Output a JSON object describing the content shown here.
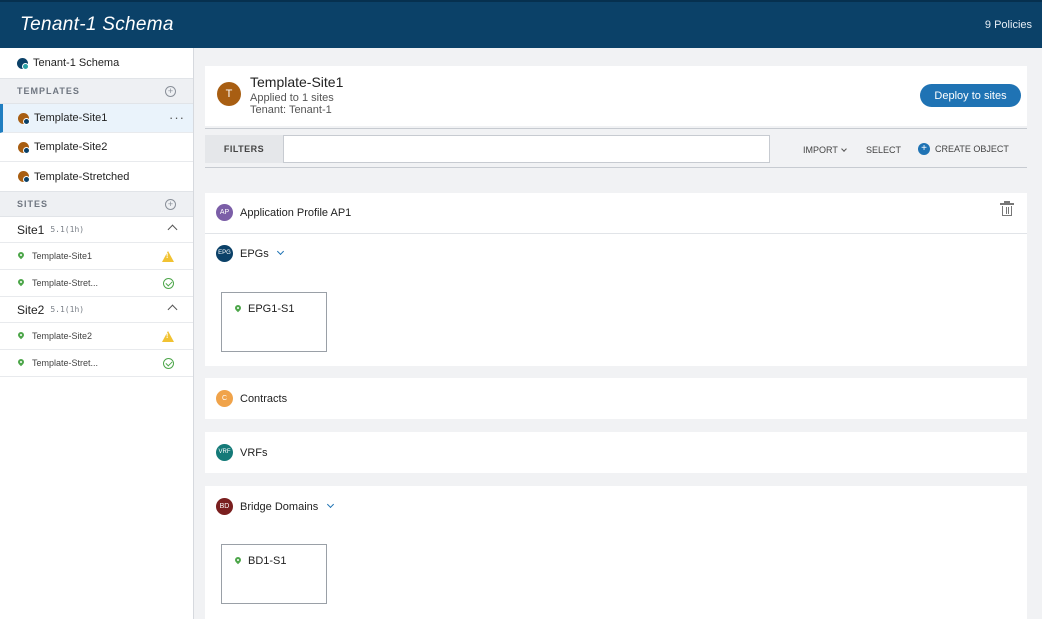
{
  "header": {
    "title": "Tenant-1 Schema",
    "policies": "9 Policies"
  },
  "sidebar": {
    "schema_label": "Tenant-1 Schema",
    "templates_heading": "TEMPLATES",
    "templates": [
      {
        "label": "Template-Site1",
        "active": true,
        "more": "···"
      },
      {
        "label": "Template-Site2"
      },
      {
        "label": "Template-Stretched"
      }
    ],
    "sites_heading": "SITES",
    "sites": [
      {
        "name": "Site1",
        "version": "5.1(1h)",
        "templates": [
          {
            "label": "Template-Site1",
            "status": "warning"
          },
          {
            "label": "Template-Stret...",
            "status": "ok"
          }
        ]
      },
      {
        "name": "Site2",
        "version": "5.1(1h)",
        "templates": [
          {
            "label": "Template-Site2",
            "status": "warning"
          },
          {
            "label": "Template-Stret...",
            "status": "ok"
          }
        ]
      }
    ]
  },
  "template_header": {
    "avatar": "T",
    "name": "Template-Site1",
    "applied": "Applied to 1 sites",
    "tenant": "Tenant: Tenant-1",
    "deploy_label": "Deploy to sites"
  },
  "filterbar": {
    "filters_label": "FILTERS",
    "filter_value": "",
    "import_label": "IMPORT",
    "select_label": "SELECT",
    "create_label": "CREATE OBJECT"
  },
  "app_profile": {
    "badge": "AP",
    "label": "Application Profile AP1"
  },
  "epgs": {
    "badge": "EPG",
    "label": "EPGs",
    "items": [
      "EPG1-S1"
    ]
  },
  "contracts": {
    "badge": "C",
    "label": "Contracts"
  },
  "vrfs": {
    "badge": "VRF",
    "label": "VRFs"
  },
  "bridge_domains": {
    "badge": "BD",
    "label": "Bridge Domains",
    "items": [
      "BD1-S1"
    ]
  },
  "colors": {
    "header_bg": "#0b4168",
    "accent": "#1f73b4",
    "template_icon": "#a85e12",
    "ap_badge": "#7b5ea7",
    "epg_badge": "#0b4168",
    "contract_badge": "#f0a34a",
    "vrf_badge": "#147a78",
    "bd_badge": "#7a1f1f",
    "warning": "#f1c232",
    "ok": "#4da64a"
  }
}
